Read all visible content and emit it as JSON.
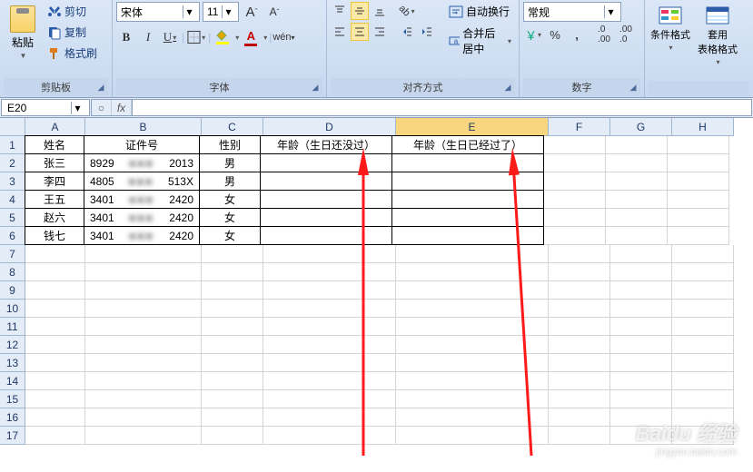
{
  "clipboard": {
    "paste": "粘贴",
    "cut": "剪切",
    "copy": "复制",
    "format": "格式刷",
    "group": "剪贴板"
  },
  "font": {
    "name": "宋体",
    "size": "11",
    "increaseA": "A",
    "decreaseA": "A",
    "bold": "B",
    "italic": "I",
    "underline": "U",
    "group": "字体"
  },
  "align": {
    "wrap": "自动换行",
    "merge": "合并后居中",
    "group": "对齐方式"
  },
  "number": {
    "format": "常规",
    "group": "数字"
  },
  "styles": {
    "conditional": "条件格式",
    "table": "套用\n表格格式"
  },
  "formula_bar": {
    "name_box": "E20",
    "fx": "fx"
  },
  "columns": [
    "A",
    "B",
    "C",
    "D",
    "E",
    "F",
    "G",
    "H"
  ],
  "col_widths": [
    "cA",
    "cB",
    "cC",
    "cD",
    "cE",
    "cF",
    "cG",
    "cH"
  ],
  "selected_col": "E",
  "rows": [
    1,
    2,
    3,
    4,
    5,
    6,
    7,
    8,
    9,
    10,
    11,
    12,
    13,
    14,
    15,
    16,
    17
  ],
  "table": {
    "headers": {
      "A": "姓名",
      "B": "证件号",
      "C": "性别",
      "D": "年龄（生日还没过）",
      "E": "年龄（生日已经过了）"
    },
    "data": [
      {
        "A": "张三",
        "B_pre": "8929",
        "B_hidden": "■■■",
        "B_suf": "2013",
        "C": "男"
      },
      {
        "A": "李四",
        "B_pre": "4805",
        "B_hidden": "■■■",
        "B_suf": "513X",
        "C": "男"
      },
      {
        "A": "王五",
        "B_pre": "3401",
        "B_hidden": "■■■",
        "B_suf": "2420",
        "C": "女"
      },
      {
        "A": "赵六",
        "B_pre": "3401",
        "B_hidden": "■■■",
        "B_suf": "2420",
        "C": "女"
      },
      {
        "A": "钱七",
        "B_pre": "3401",
        "B_hidden": "■■■",
        "B_suf": "2420",
        "C": "女"
      }
    ]
  },
  "watermark": {
    "brand": "Baidu 经验",
    "url": "jingyan.baidu.com"
  }
}
